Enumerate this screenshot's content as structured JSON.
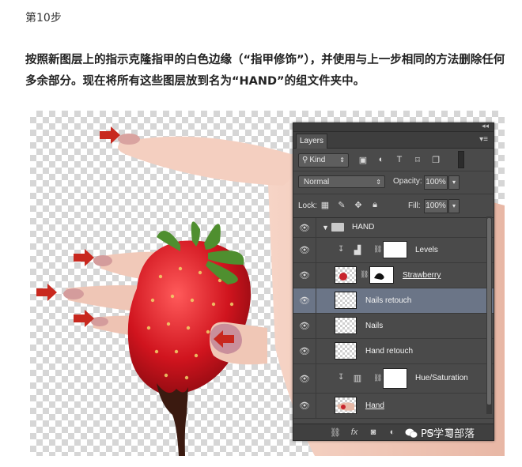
{
  "step_title": "第10步",
  "description": "按照新图层上的指示克隆指甲的白色边缘（“指甲修饰”），并使用与上一步相同的方法删除任何多余部分。现在将所有这些图层放到名为“HAND”的组文件夹中。",
  "layers_panel": {
    "tab_label": "Layers",
    "kind_label": "Kind",
    "blend_mode": "Normal",
    "opacity_label": "Opacity:",
    "opacity_value": "100%",
    "lock_label": "Lock:",
    "fill_label": "Fill:",
    "fill_value": "100%",
    "layers": [
      {
        "name": "HAND",
        "type": "group"
      },
      {
        "name": "Levels",
        "type": "adjustment",
        "icon": "levels-icon"
      },
      {
        "name": "Strawberry",
        "type": "masked"
      },
      {
        "name": "Nails retouch",
        "type": "pixel",
        "selected": true
      },
      {
        "name": "Nails",
        "type": "pixel"
      },
      {
        "name": "Hand retouch",
        "type": "pixel"
      },
      {
        "name": "Hue/Saturation",
        "type": "adjustment",
        "icon": "hue-saturation-icon"
      },
      {
        "name": "Hand",
        "type": "pixel"
      }
    ]
  },
  "watermark": "PS学习部落",
  "colors": {
    "arrow": "#c8281e",
    "panel_bg": "#4a4a4a",
    "selected_row": "#6b7587"
  }
}
